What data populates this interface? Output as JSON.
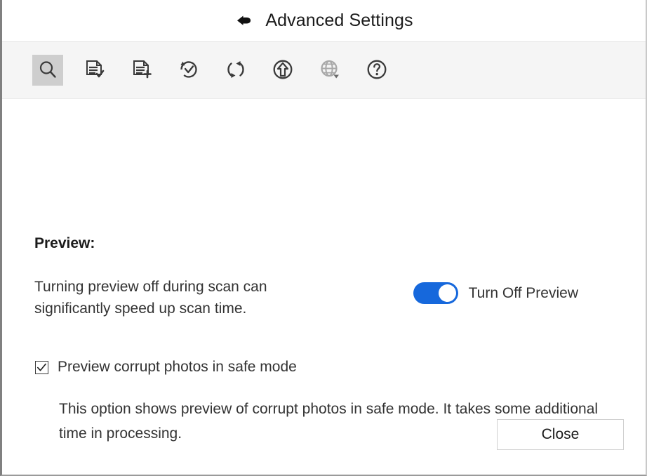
{
  "window": {
    "title": "Advanced Settings",
    "back_icon": "back-arrow-icon"
  },
  "toolbar": {
    "items": [
      {
        "name": "search-scan",
        "icon": "magnifier-icon",
        "selected": true,
        "disabled": false
      },
      {
        "name": "document-check",
        "icon": "document-check-icon",
        "selected": false,
        "disabled": false
      },
      {
        "name": "document-add",
        "icon": "document-add-icon",
        "selected": false,
        "disabled": false
      },
      {
        "name": "history-check",
        "icon": "circular-arrow-check-icon",
        "selected": false,
        "disabled": false
      },
      {
        "name": "refresh",
        "icon": "refresh-sync-icon",
        "selected": false,
        "disabled": false
      },
      {
        "name": "upload",
        "icon": "upload-circle-icon",
        "selected": false,
        "disabled": false
      },
      {
        "name": "language",
        "icon": "globe-dropdown-icon",
        "selected": false,
        "disabled": true
      },
      {
        "name": "help",
        "icon": "question-circle-icon",
        "selected": false,
        "disabled": false
      }
    ]
  },
  "preview_section": {
    "heading": "Preview:",
    "description": "Turning preview off during scan can significantly speed up scan time.",
    "toggle_label": "Turn Off Preview",
    "toggle_on": true,
    "checkbox_label": "Preview corrupt photos in safe mode",
    "checkbox_checked": true,
    "option_description": "This option shows preview of corrupt photos in safe mode. It takes some additional time in processing."
  },
  "footer": {
    "close_label": "Close"
  },
  "colors": {
    "accent": "#1668dc",
    "toolbar_bg": "#f5f5f5",
    "selected_tool_bg": "#cecece",
    "icon_stroke": "#3a3a3a",
    "disabled_icon": "#a8a8a8",
    "text": "#333333"
  }
}
